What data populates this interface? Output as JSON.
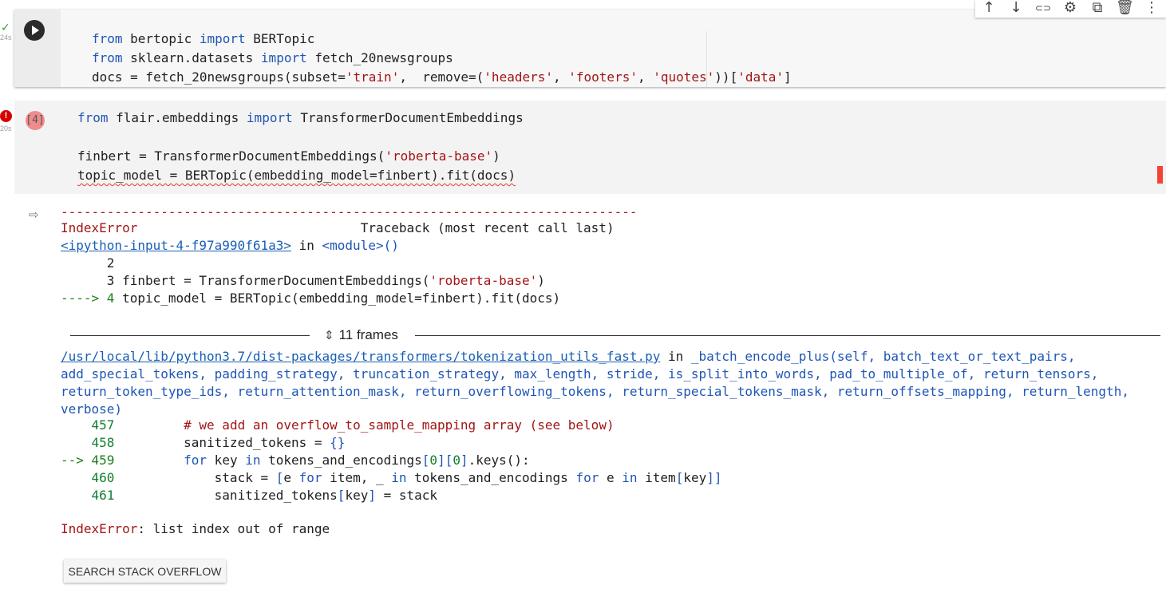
{
  "cell1": {
    "status_icon": "check-icon",
    "status_glyph": "✓",
    "exec_time": "24s",
    "lines": [
      [
        {
          "t": "from",
          "c": "kw"
        },
        {
          "t": " bertopic "
        },
        {
          "t": "import",
          "c": "kw"
        },
        {
          "t": " BERTopic"
        }
      ],
      [
        {
          "t": "from",
          "c": "kw"
        },
        {
          "t": " sklearn.datasets "
        },
        {
          "t": "import",
          "c": "kw"
        },
        {
          "t": " fetch_20newsgroups"
        }
      ],
      [
        {
          "t": "docs = fetch_20newsgroups(subset="
        },
        {
          "t": "'train'",
          "c": "str"
        },
        {
          "t": ",  remove=("
        },
        {
          "t": "'headers'",
          "c": "str"
        },
        {
          "t": ", "
        },
        {
          "t": "'footers'",
          "c": "str"
        },
        {
          "t": ", "
        },
        {
          "t": "'quotes'",
          "c": "str"
        },
        {
          "t": "))["
        },
        {
          "t": "'data'",
          "c": "str"
        },
        {
          "t": "]"
        }
      ]
    ]
  },
  "toolbar": {
    "icons": [
      {
        "name": "arrow-up-icon",
        "glyph": "↑"
      },
      {
        "name": "arrow-down-icon",
        "glyph": "↓"
      },
      {
        "name": "link-icon",
        "glyph": "⊂⊃"
      },
      {
        "name": "gear-icon",
        "glyph": "⚙"
      },
      {
        "name": "mirror-cell-icon",
        "glyph": "⧉"
      },
      {
        "name": "trash-icon",
        "glyph": "🗑"
      },
      {
        "name": "more-vert-icon",
        "glyph": "⋮"
      }
    ]
  },
  "cell2": {
    "error_badge": "!",
    "exec_time": "20s",
    "exec_count": "[4]",
    "lines": [
      [
        {
          "t": "from",
          "c": "kw"
        },
        {
          "t": " flair.embeddings "
        },
        {
          "t": "import",
          "c": "kw"
        },
        {
          "t": " TransformerDocumentEmbeddings"
        }
      ],
      [],
      [
        {
          "t": "finbert = TransformerDocumentEmbeddings("
        },
        {
          "t": "'roberta-base'",
          "c": "str"
        },
        {
          "t": ")"
        }
      ],
      [
        {
          "t": "topic_model = BERTopic(embedding_model=finbert).fit(docs)",
          "c": "squiggle"
        }
      ]
    ]
  },
  "output": {
    "icon": "output-redirect-icon",
    "dashes": "---------------------------------------------------------------------------",
    "error_type": "IndexError",
    "traceback_header": "Traceback (most recent call last)",
    "input_link": "<ipython-input-4-f97a990f61a3>",
    "in_word": " in ",
    "module": "<module>",
    "module_parens": "()",
    "ctx_lines": [
      [
        {
          "t": "      2"
        }
      ],
      [
        {
          "t": "      3 finbert = TransformerDocumentEmbeddings("
        },
        {
          "t": "'roberta-base'",
          "c": "str"
        },
        {
          "t": ")"
        }
      ],
      [
        {
          "t": "----> 4 ",
          "c": "grn"
        },
        {
          "t": "topic_model = BERTopic(embedding_model=finbert).fit(docs)"
        }
      ]
    ],
    "frames_label": "11 frames",
    "file_link": "/usr/local/lib/python3.7/dist-packages/transformers/tokenization_utils_fast.py",
    "sig_lines": [
      [
        {
          "t": " in "
        },
        {
          "t": "_batch_encode_plus",
          "c": "blue"
        },
        {
          "t": "(self, batch_text_or_text_pairs,",
          "c": "blue"
        }
      ],
      [
        {
          "t": "add_special_tokens, padding_strategy, truncation_strategy, max_length, stride, is_split_into_words, pad_to_multiple_of, return_tensors,",
          "c": "blue"
        }
      ],
      [
        {
          "t": "return_token_type_ids, return_attention_mask, return_overflowing_tokens, return_special_tokens_mask, return_offsets_mapping, return_length,",
          "c": "blue"
        }
      ],
      [
        {
          "t": "verbose)",
          "c": "blue"
        }
      ]
    ],
    "src_lines": [
      [
        {
          "t": "    457",
          "c": "num"
        },
        {
          "t": "         "
        },
        {
          "t": "# we add an overflow_to_sample_mapping array (see below)",
          "c": "cmt"
        }
      ],
      [
        {
          "t": "    458",
          "c": "num"
        },
        {
          "t": "         sanitized_tokens = "
        },
        {
          "t": "{}",
          "c": "blue"
        }
      ],
      [
        {
          "t": "--> 459",
          "c": "grn"
        },
        {
          "t": "         "
        },
        {
          "t": "for",
          "c": "kw"
        },
        {
          "t": " key "
        },
        {
          "t": "in",
          "c": "kw"
        },
        {
          "t": " tokens_and_encodings"
        },
        {
          "t": "[",
          "c": "blue"
        },
        {
          "t": "0",
          "c": "num"
        },
        {
          "t": "][",
          "c": "blue"
        },
        {
          "t": "0",
          "c": "num"
        },
        {
          "t": "]",
          "c": "blue"
        },
        {
          "t": ".keys():"
        }
      ],
      [
        {
          "t": "    460",
          "c": "num"
        },
        {
          "t": "             stack = "
        },
        {
          "t": "[",
          "c": "blue"
        },
        {
          "t": "e "
        },
        {
          "t": "for",
          "c": "kw"
        },
        {
          "t": " item, _ "
        },
        {
          "t": "in",
          "c": "kw"
        },
        {
          "t": " tokens_and_encodings "
        },
        {
          "t": "for",
          "c": "kw"
        },
        {
          "t": " e "
        },
        {
          "t": "in",
          "c": "kw"
        },
        {
          "t": " item"
        },
        {
          "t": "[",
          "c": "blue"
        },
        {
          "t": "key"
        },
        {
          "t": "]]",
          "c": "blue"
        }
      ],
      [
        {
          "t": "    461",
          "c": "num"
        },
        {
          "t": "             sanitized_tokens"
        },
        {
          "t": "[",
          "c": "blue"
        },
        {
          "t": "key"
        },
        {
          "t": "]",
          "c": "blue"
        },
        {
          "t": " = stack"
        }
      ]
    ],
    "final_error_type": "IndexError",
    "final_error_msg": ": list index out of range",
    "search_button": "SEARCH STACK OVERFLOW"
  }
}
